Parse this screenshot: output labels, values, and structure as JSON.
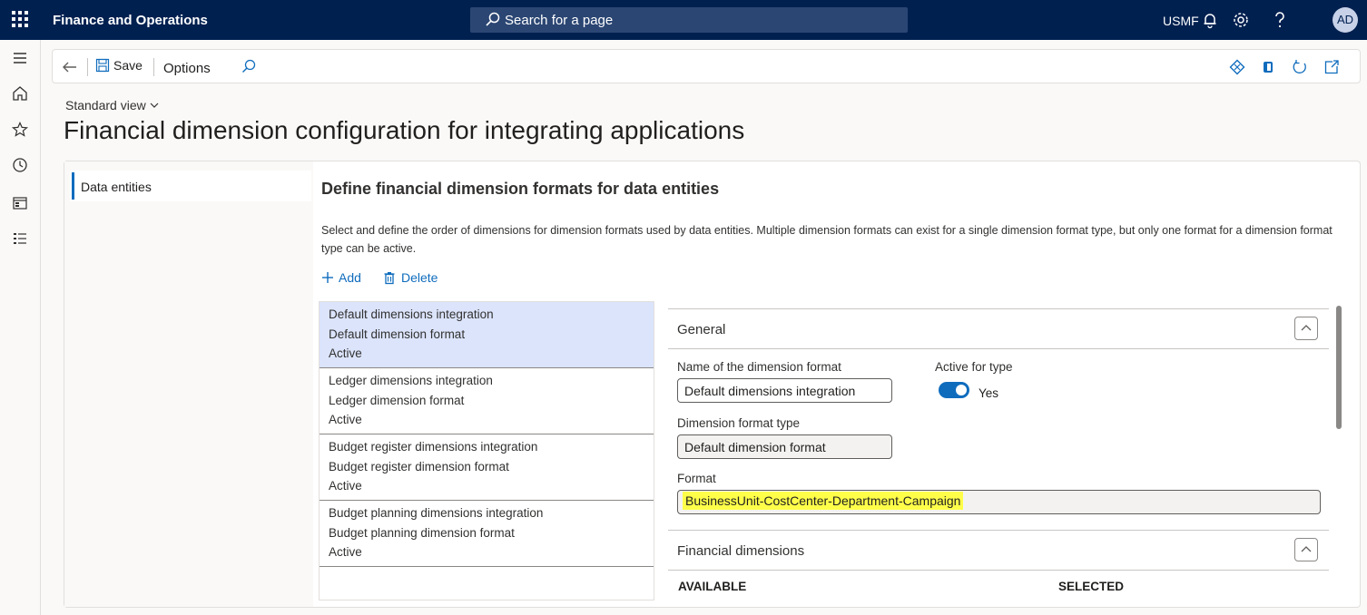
{
  "topbar": {
    "app_title": "Finance and Operations",
    "search_placeholder": "Search for a page",
    "company": "USMF",
    "avatar_initials": "AD"
  },
  "actionbar": {
    "save_label": "Save",
    "options_label": "Options"
  },
  "page": {
    "view_name": "Standard view",
    "title": "Financial dimension configuration for integrating applications"
  },
  "nav": {
    "items": [
      {
        "label": "Data entities"
      }
    ]
  },
  "section": {
    "title": "Define financial dimension formats for data entities",
    "description": "Select and define the order of dimensions for dimension formats used by data entities. Multiple dimension formats can exist for a single dimension format type, but only one format for a dimension format type can be active.",
    "add_label": "Add",
    "delete_label": "Delete"
  },
  "formats_list": [
    {
      "name": "Default dimensions integration",
      "type": "Default dimension format",
      "status": "Active"
    },
    {
      "name": "Ledger dimensions integration",
      "type": "Ledger dimension format",
      "status": "Active"
    },
    {
      "name": "Budget register dimensions integration",
      "type": "Budget register dimension format",
      "status": "Active"
    },
    {
      "name": "Budget planning dimensions integration",
      "type": "Budget planning dimension format",
      "status": "Active"
    }
  ],
  "detail": {
    "general_title": "General",
    "name_label": "Name of the dimension format",
    "name_value": "Default dimensions integration",
    "active_label": "Active for type",
    "active_value": "Yes",
    "type_label": "Dimension format type",
    "type_value": "Default dimension format",
    "format_label": "Format",
    "format_value": "BusinessUnit-CostCenter-Department-Campaign",
    "fin_dims_title": "Financial dimensions",
    "available_label": "AVAILABLE",
    "selected_label": "SELECTED"
  },
  "colors": {
    "topbar": "#002050",
    "accent": "#0f6cbd",
    "selected_row": "#dbe4fb",
    "highlight": "#ffff4a"
  }
}
